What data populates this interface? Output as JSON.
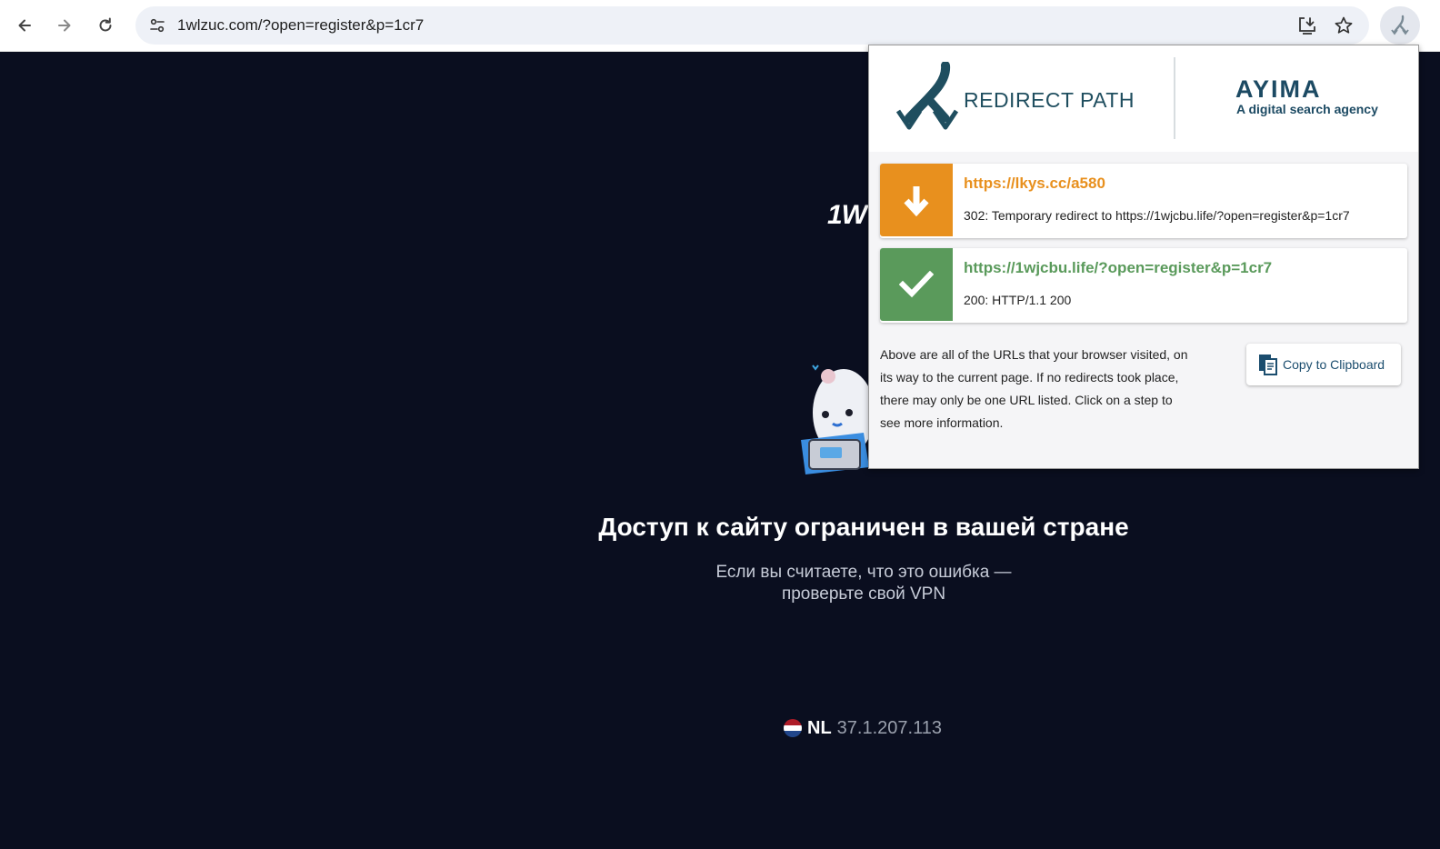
{
  "browser": {
    "url": "1wlzuc.com/?open=register&p=1cr7"
  },
  "page": {
    "brand_partial": "1W",
    "headline": "Доступ к сайту ограничен в вашей стране",
    "subtext_line1": "Если вы считаете, что это ошибка —",
    "subtext_line2": "проверьте свой VPN",
    "country_code": "NL",
    "ip_address": "37.1.207.113"
  },
  "popup": {
    "title": "REDIRECT PATH",
    "partner_name": "AYIMA",
    "partner_tagline": "A digital search agency",
    "steps": [
      {
        "url": "https://lkys.cc/a580",
        "description": "302: Temporary redirect to https://1wjcbu.life/?open=register&p=1cr7",
        "status_icon": "arrow-down-icon",
        "color": "#e8901e"
      },
      {
        "url": "https://1wjcbu.life/?open=register&p=1cr7",
        "description": "200: HTTP/1.1 200",
        "status_icon": "checkmark-icon",
        "color": "#5a9a5b"
      }
    ],
    "info_text": "Above are all of the URLs that your browser visited, on its way to the current page. If no redirects took place, there may only be one URL listed. Click on a step to see more information.",
    "copy_button_label": "Copy to Clipboard"
  },
  "colors": {
    "page_background": "#0a0e1f",
    "brand_teal": "#1f4e5f",
    "redirect_orange": "#e8901e",
    "ok_green": "#5a9a5b"
  }
}
